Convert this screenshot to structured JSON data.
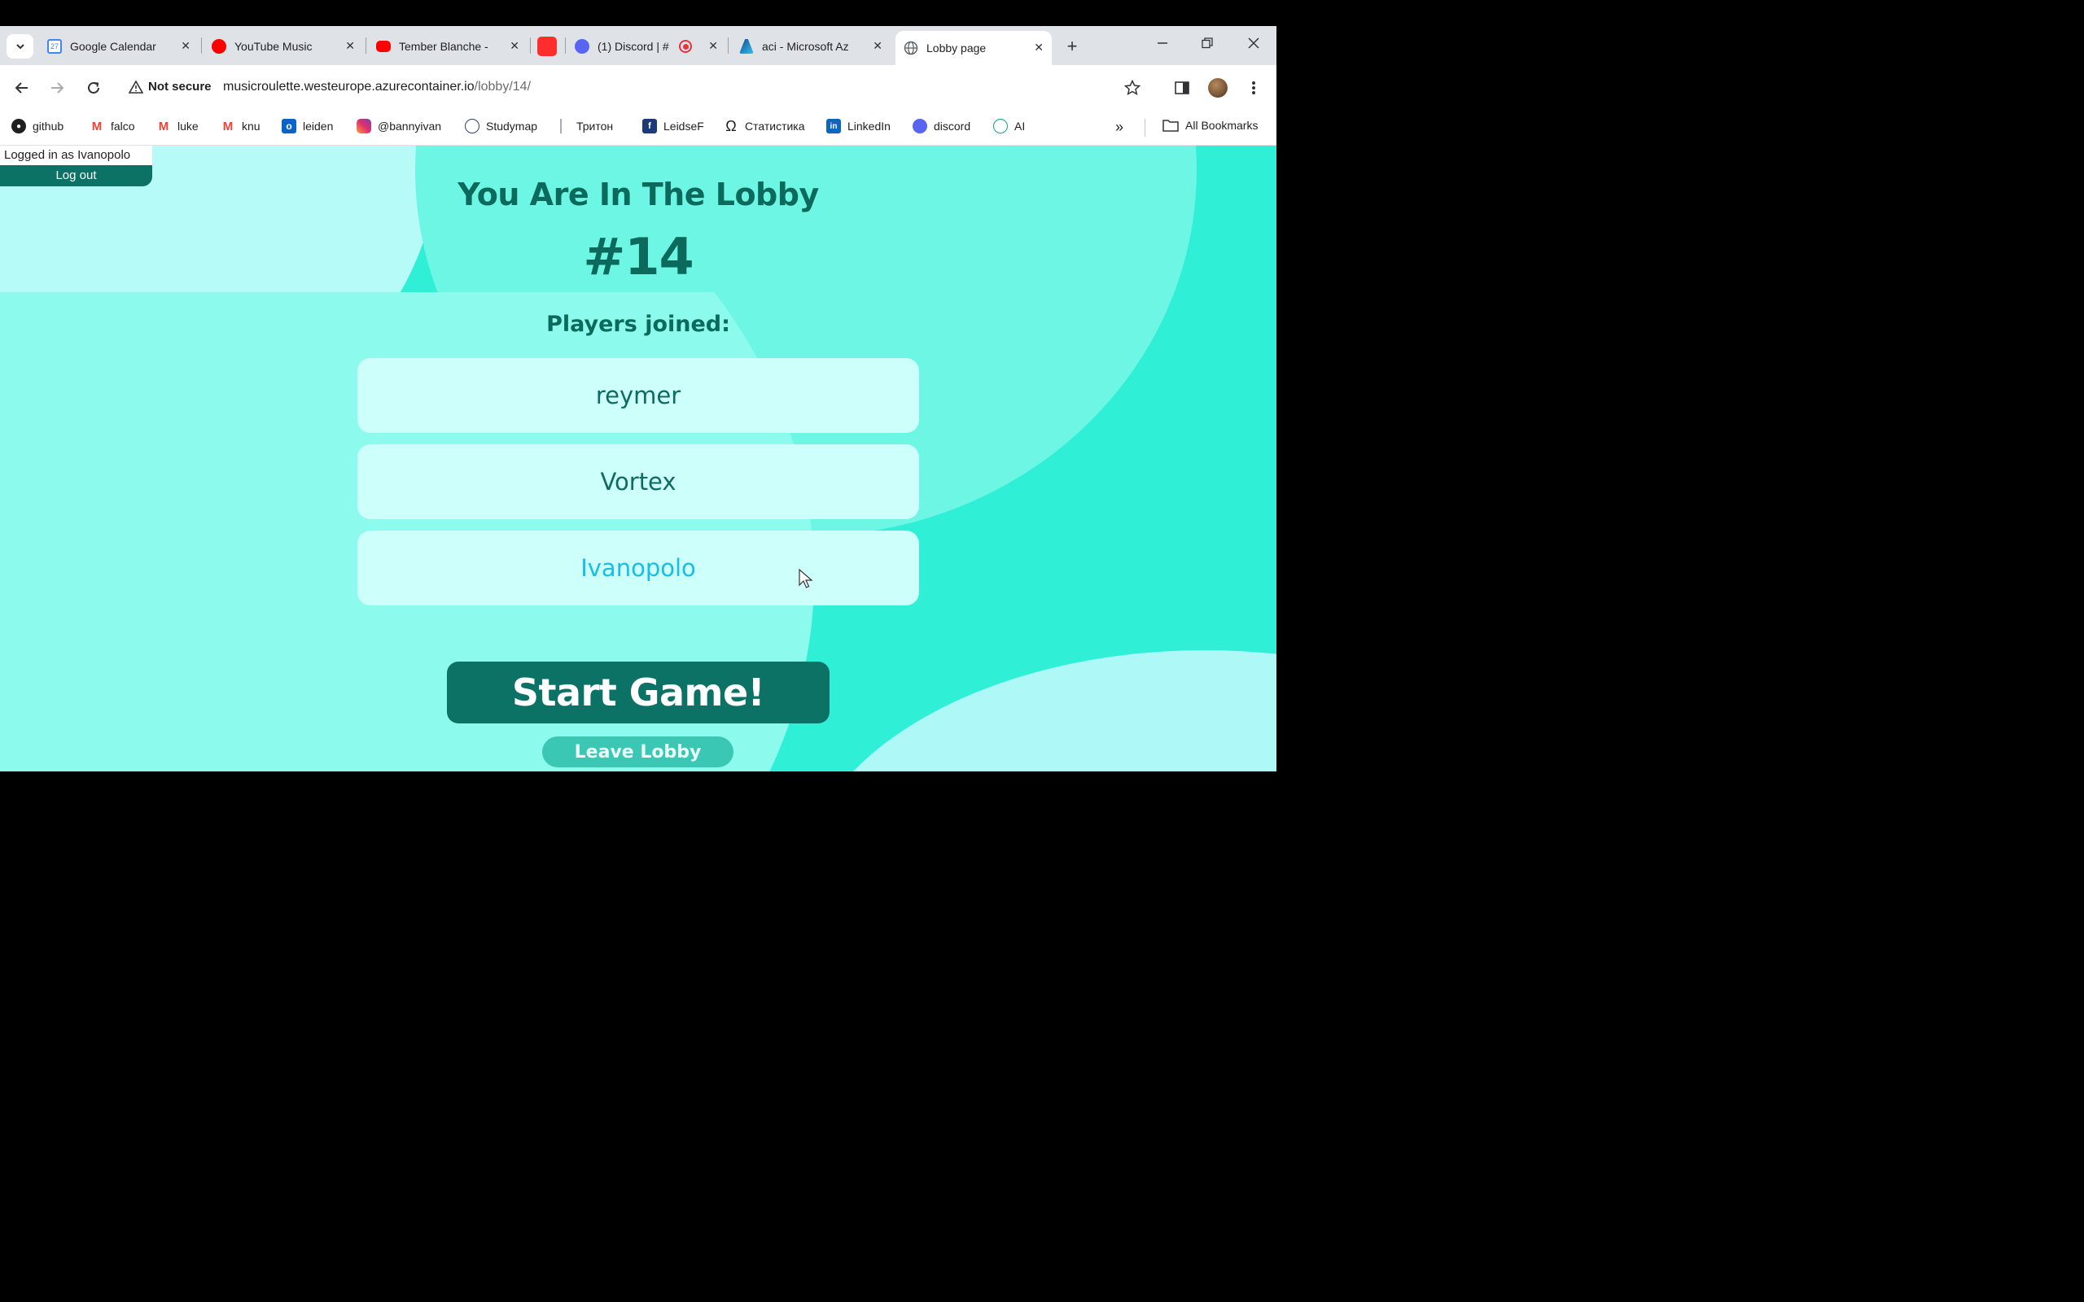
{
  "browser": {
    "tabs": [
      {
        "title": "Google Calendar",
        "favicon": "calendar-icon",
        "color": "#4285f4"
      },
      {
        "title": "YouTube Music",
        "favicon": "youtube-music-icon",
        "color": "#ff0000"
      },
      {
        "title": "Tember Blanche -",
        "favicon": "youtube-icon",
        "color": "#ff0000"
      },
      {
        "title": "",
        "favicon": "app-red-icon",
        "color": "#ff2d2d"
      },
      {
        "title": "(1) Discord | #",
        "favicon": "discord-icon",
        "color": "#5865f2"
      },
      {
        "title": "aci - Microsoft Az",
        "favicon": "azure-icon",
        "color": "#0078d4"
      },
      {
        "title": "Lobby page",
        "favicon": "globe-icon",
        "color": "#5f6368",
        "active": true
      }
    ],
    "security_label": "Not secure",
    "url_host": "musicroulette.westeurope.azurecontainer.io",
    "url_path": "/lobby/14/",
    "bookmarks": [
      {
        "label": "github",
        "icon": "github-icon"
      },
      {
        "label": "falco",
        "icon": "gmail-icon"
      },
      {
        "label": "luke",
        "icon": "gmail-icon"
      },
      {
        "label": "knu",
        "icon": "gmail-icon"
      },
      {
        "label": "leiden",
        "icon": "outlook-icon"
      },
      {
        "label": "@bannyivan",
        "icon": "instagram-icon"
      },
      {
        "label": "Studymap",
        "icon": "studymap-icon"
      },
      {
        "label": "Тритон",
        "icon": "page-icon"
      },
      {
        "label": "LeidseF",
        "icon": "leidsef-icon"
      },
      {
        "label": "Статистика",
        "icon": "omega-icon"
      },
      {
        "label": "LinkedIn",
        "icon": "linkedin-icon"
      },
      {
        "label": "discord",
        "icon": "discord-icon"
      },
      {
        "label": "AI",
        "icon": "openai-icon"
      }
    ],
    "all_bookmarks_label": "All Bookmarks"
  },
  "page": {
    "logged_in_text": "Logged in as Ivanopolo",
    "logout_label": "Log out",
    "title": "You Are In The Lobby",
    "lobby_number": "#14",
    "players_heading": "Players joined:",
    "players": [
      "reymer",
      "Vortex",
      "Ivanopolo"
    ],
    "start_label": "Start Game!",
    "leave_label": "Leave Lobby"
  },
  "colors": {
    "accent_dark": "#0b7265",
    "background": "#2ff0d6",
    "current_player": "#19bde6"
  }
}
